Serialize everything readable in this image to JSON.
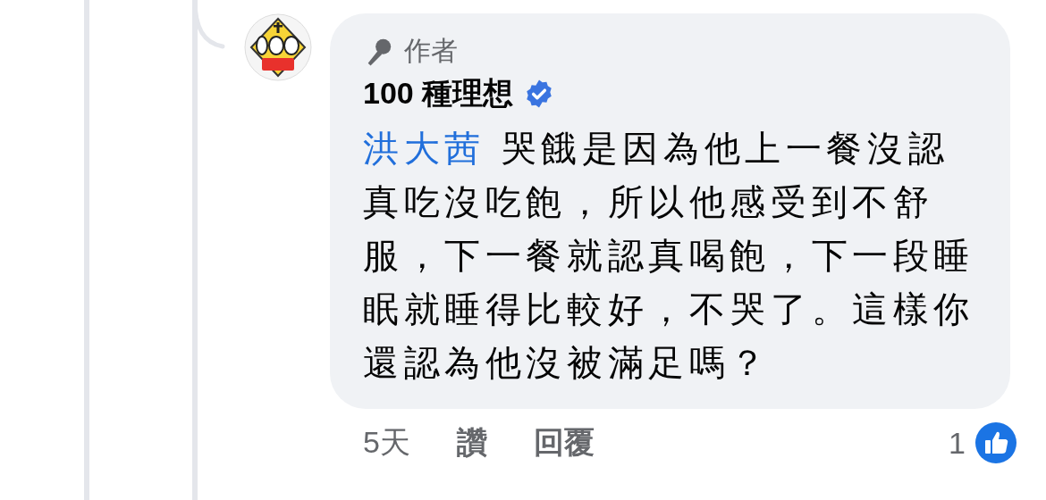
{
  "comment": {
    "badge": "作者",
    "author": "100 種理想",
    "verified": true,
    "mention": "洪大茜",
    "text": "哭餓是因為他上一餐沒認真吃沒吃飽，所以他感受到不舒服，下一餐就認真喝飽，下一段睡眠就睡得比較好，不哭了。這樣你還認為他沒被滿足嗎？"
  },
  "footer": {
    "time": "5天",
    "actions": [
      "讚",
      "回覆"
    ],
    "reaction_count": "1"
  }
}
